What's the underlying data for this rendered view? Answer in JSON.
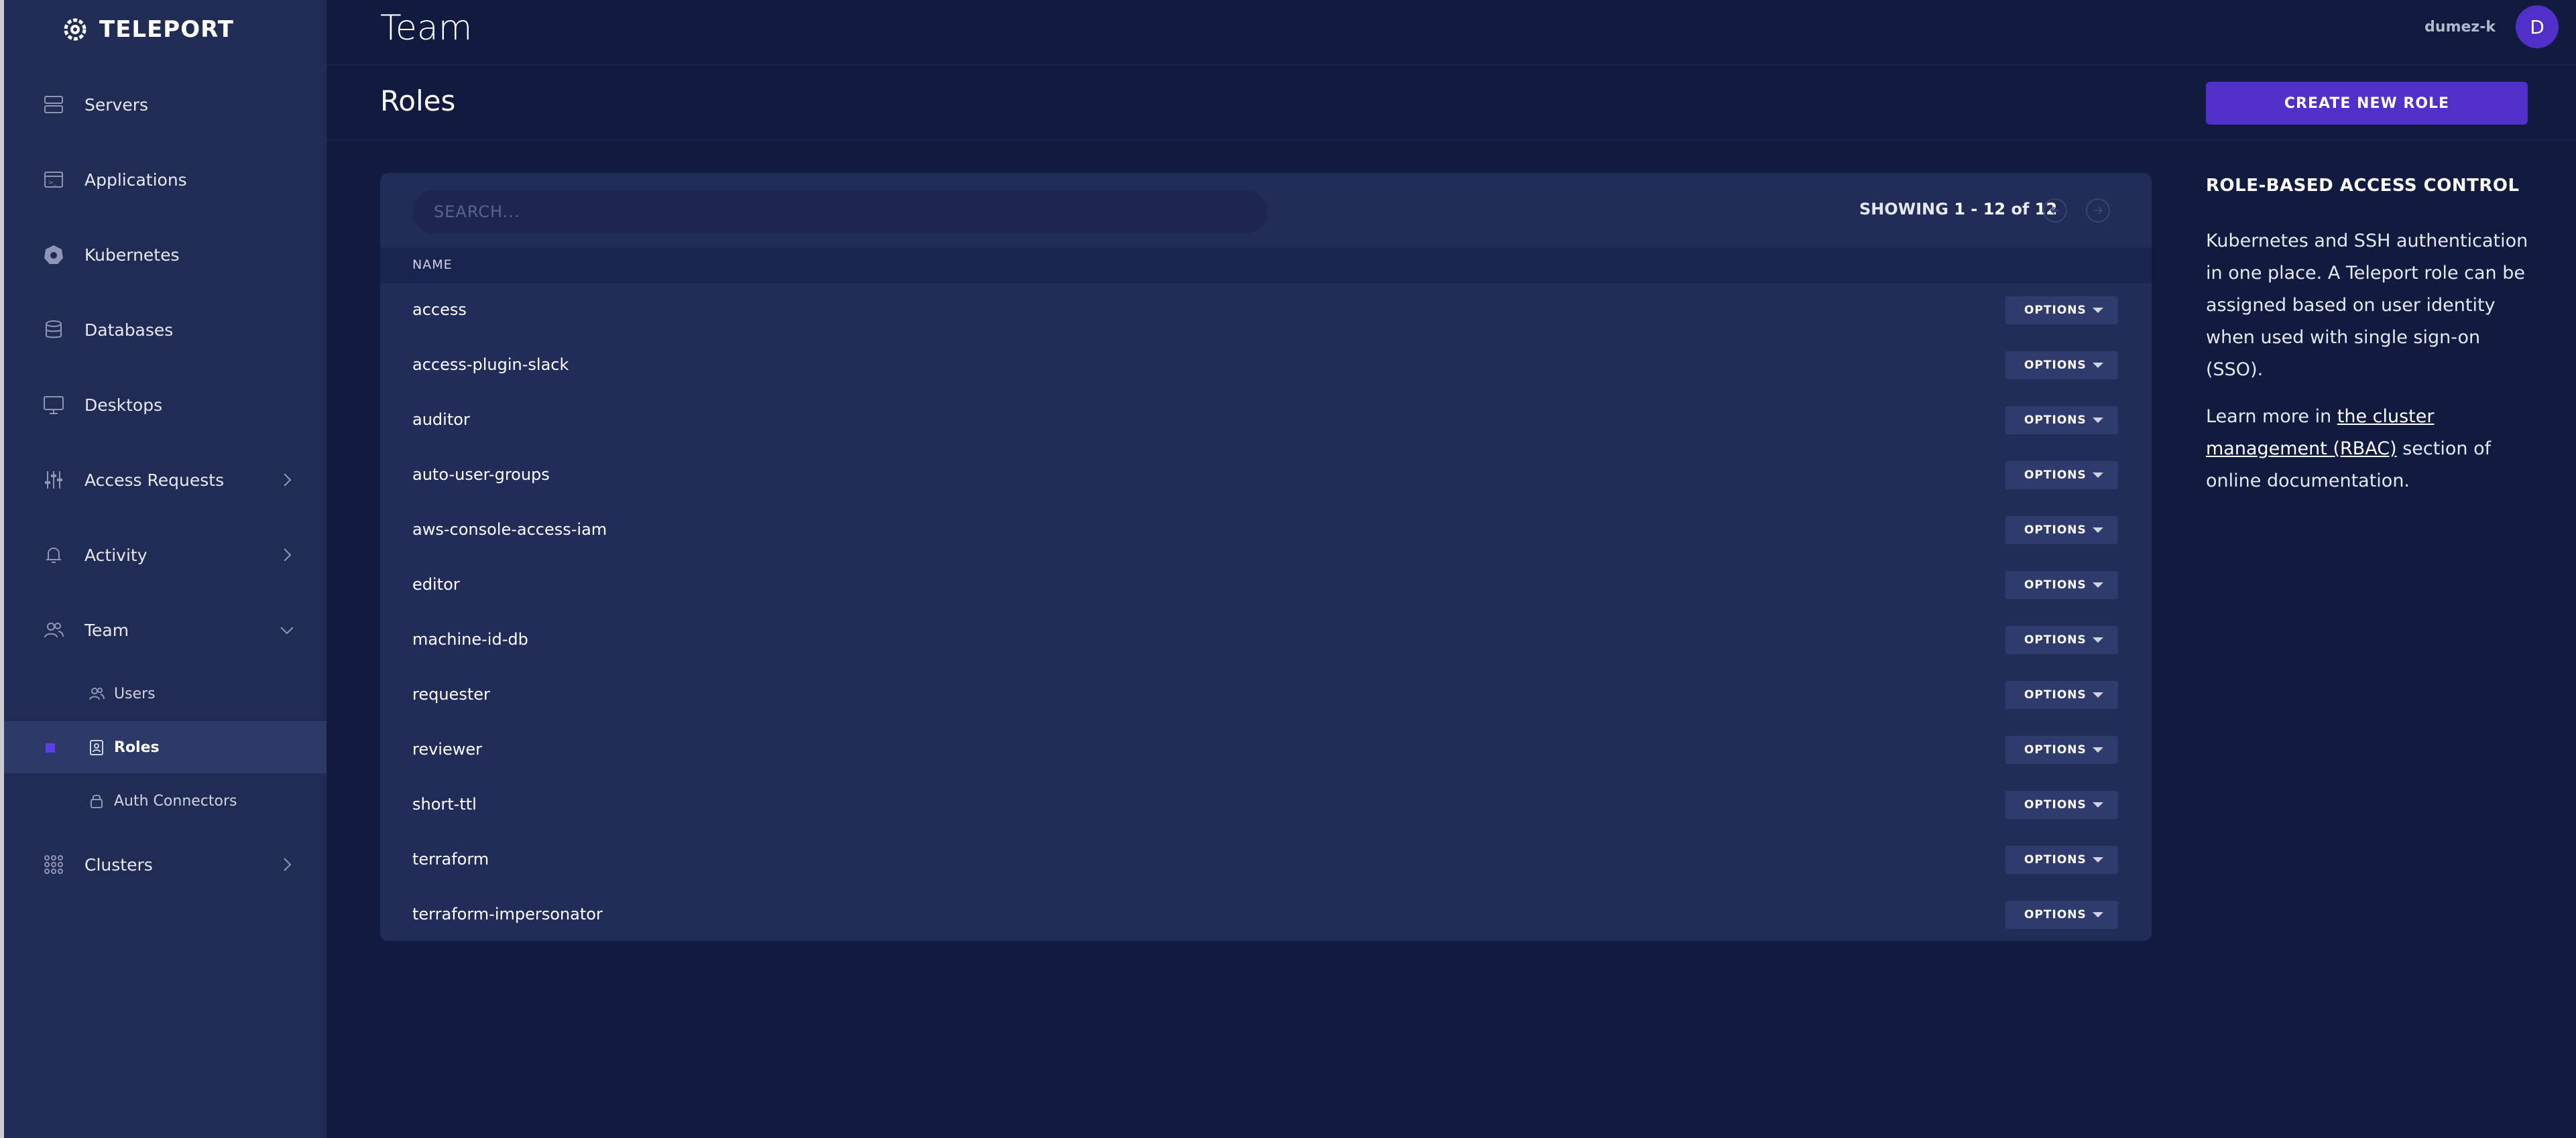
{
  "brand": {
    "name": "TELEPORT"
  },
  "sidebar": {
    "items": [
      {
        "label": "Servers",
        "icon": "server-icon"
      },
      {
        "label": "Applications",
        "icon": "application-icon"
      },
      {
        "label": "Kubernetes",
        "icon": "kubernetes-icon"
      },
      {
        "label": "Databases",
        "icon": "database-icon"
      },
      {
        "label": "Desktops",
        "icon": "desktop-icon"
      },
      {
        "label": "Access Requests",
        "icon": "sliders-icon",
        "chevron": "right"
      },
      {
        "label": "Activity",
        "icon": "bell-icon",
        "chevron": "right"
      },
      {
        "label": "Team",
        "icon": "users-icon",
        "chevron": "down",
        "expanded": true
      },
      {
        "label": "Clusters",
        "icon": "grid-icon",
        "chevron": "right"
      }
    ],
    "team_subitems": [
      {
        "label": "Users",
        "icon": "users-icon"
      },
      {
        "label": "Roles",
        "icon": "badge-icon",
        "active": true
      },
      {
        "label": "Auth Connectors",
        "icon": "lock-icon"
      }
    ]
  },
  "header": {
    "title": "Team",
    "username": "dumez-k",
    "avatar_initial": "D"
  },
  "section": {
    "title": "Roles",
    "create_button": "CREATE NEW ROLE"
  },
  "table": {
    "search_placeholder": "SEARCH...",
    "showing_prefix": "SHOWING ",
    "showing_range": "1 - 12",
    "showing_of": " of ",
    "showing_total": "12",
    "column_header": "NAME",
    "options_label": "OPTIONS",
    "rows": [
      "access",
      "access-plugin-slack",
      "auditor",
      "auto-user-groups",
      "aws-console-access-iam",
      "editor",
      "machine-id-db",
      "requester",
      "reviewer",
      "short-ttl",
      "terraform",
      "terraform-impersonator"
    ]
  },
  "info": {
    "heading": "ROLE-BASED ACCESS CONTROL",
    "paragraph1": "Kubernetes and SSH authentication in one place. A Teleport role can be assigned based on user identity when used with single sign-on (SSO).",
    "paragraph2_before": "Learn more in ",
    "paragraph2_link": "the cluster management (RBAC)",
    "paragraph2_after": " section of online documentation."
  },
  "colors": {
    "background": "#111a3f",
    "sidebar": "#212c54",
    "accent": "#512fc9",
    "card": "#222c59"
  }
}
